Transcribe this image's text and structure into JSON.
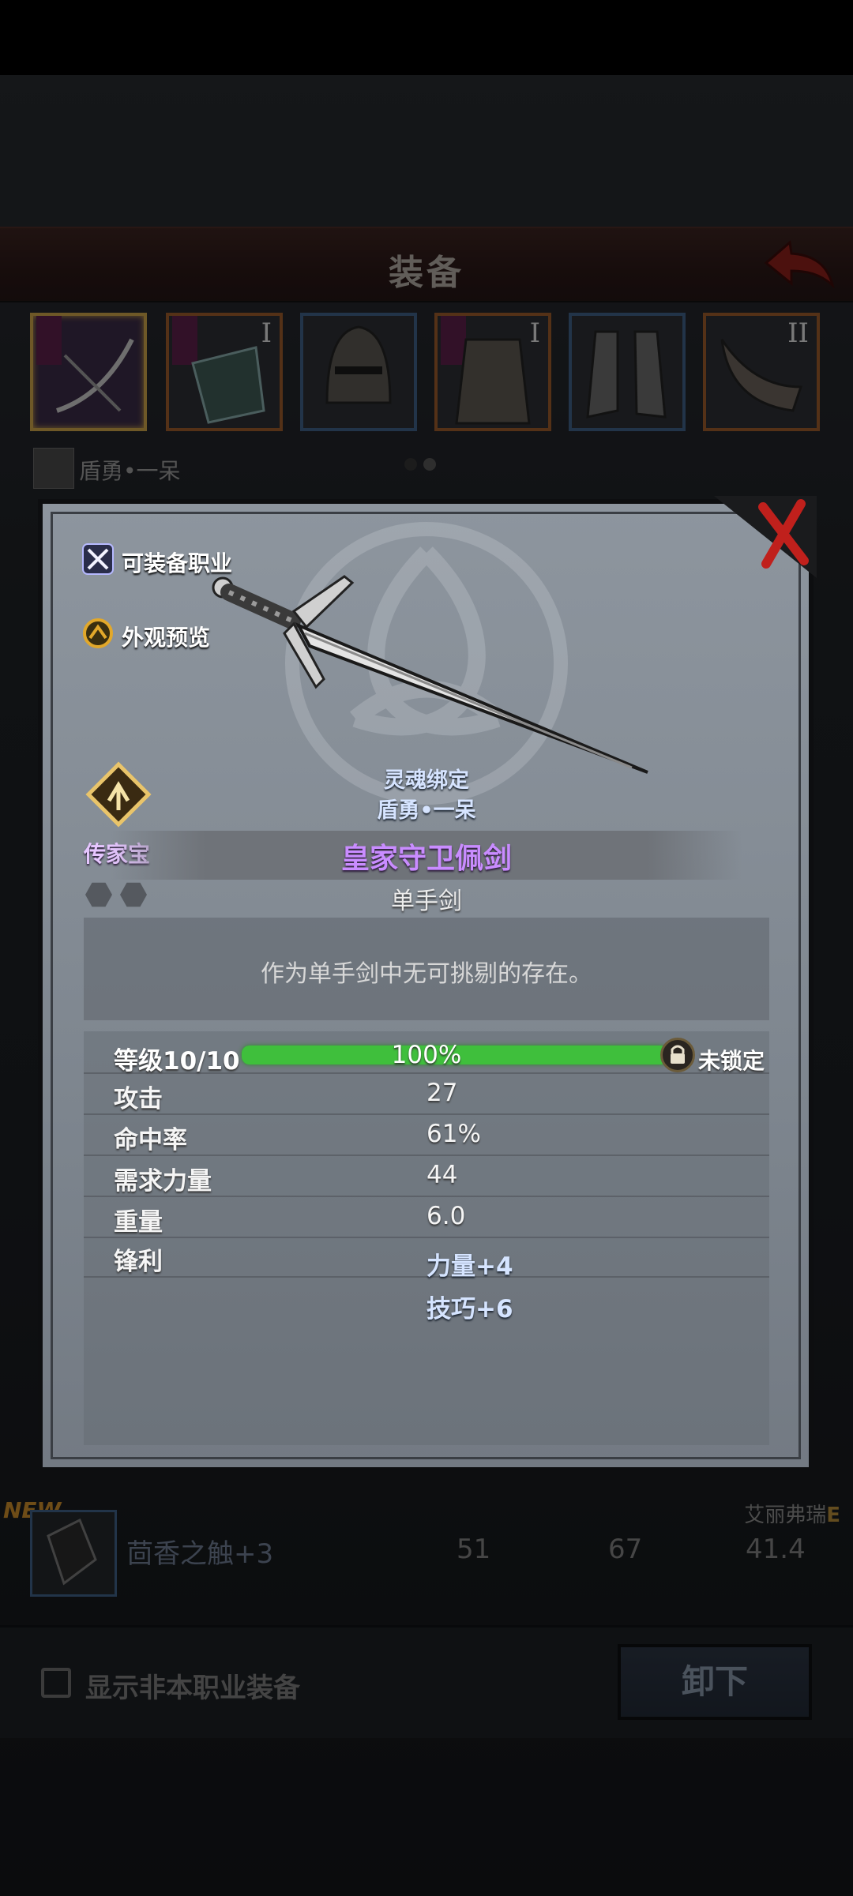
{
  "header": {
    "title": "装备"
  },
  "slots": [
    {
      "roman": "",
      "style": "sel"
    },
    {
      "roman": "I",
      "style": "orange"
    },
    {
      "roman": "",
      "style": "blue"
    },
    {
      "roman": "I",
      "style": "orange"
    },
    {
      "roman": "",
      "style": "blue"
    },
    {
      "roman": "II",
      "style": "orange"
    }
  ],
  "owner": {
    "name": "盾勇•一呆"
  },
  "list": [
    {
      "new": "NEW",
      "name": "茴香之触",
      "enhance": "+3",
      "stat1": "51",
      "stat2": "67",
      "stat3": "41.4",
      "owner": "艾丽弗瑞",
      "grade": "E"
    }
  ],
  "bottom": {
    "checkbox_label": "显示非本职业装备",
    "unequip_label": "卸下"
  },
  "modal": {
    "equip_class_label": "可装备职业",
    "appearance_label": "外观预览",
    "heirloom_label": "传家宝",
    "soulbind_title": "灵魂绑定",
    "soulbind_owner": "盾勇•一呆",
    "item_name": "皇家守卫佩剑",
    "item_type": "单手剑",
    "description": "作为单手剑中无可挑剔的存在。",
    "level": {
      "label": "等级10/10",
      "progress": 1.0,
      "percent_text": "100%",
      "lock_label": "未锁定"
    },
    "stats": [
      {
        "label": "攻击",
        "value": "27"
      },
      {
        "label": "命中率",
        "value": "61%"
      },
      {
        "label": "需求力量",
        "value": "44"
      },
      {
        "label": "重量",
        "value": "6.0"
      }
    ],
    "sharpness": {
      "label": "锋利",
      "bonuses": [
        "力量+4",
        "技巧+6"
      ]
    }
  },
  "colors": {
    "rarity_purple": "#c98cff",
    "progress_green": "#3fbf3c",
    "slot_orange": "#9a5a2a",
    "slot_blue": "#3f5f86"
  }
}
